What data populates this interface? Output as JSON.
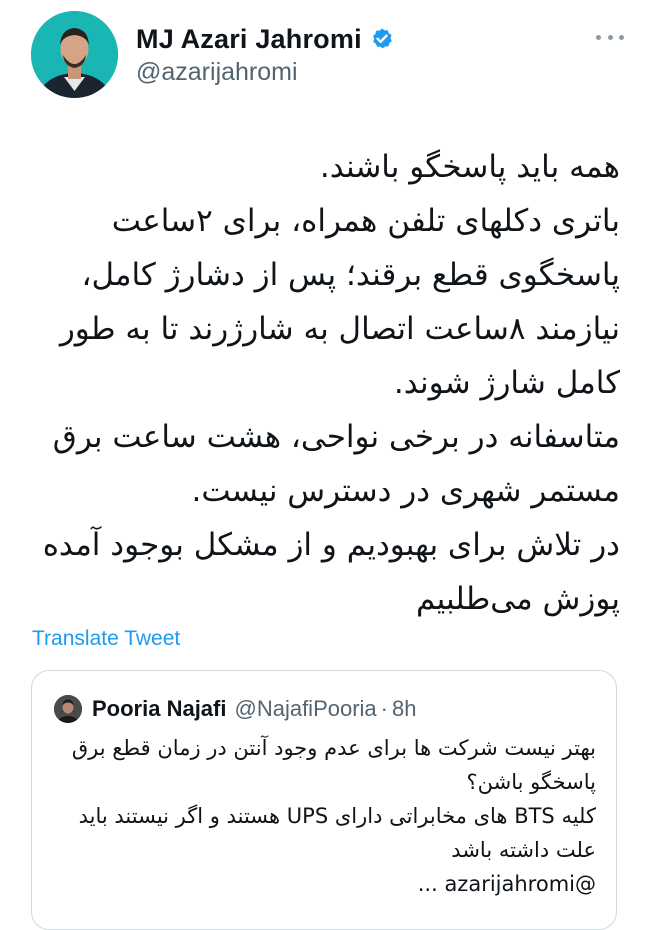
{
  "tweet": {
    "author": {
      "display_name": "MJ Azari Jahromi",
      "handle": "@azarijahromi",
      "verified": true,
      "avatar_icon": "profile-photo"
    },
    "menu_icon": "more-options-icon",
    "body_paragraphs": [
      "همه باید پاسخگو باشند.",
      "باتری دکلهای تلفن همراه، برای ۲ساعت پاسخگوی قطع برقند؛ پس از دشارژ کامل، نیازمند ۸ساعت اتصال به شارژرند تا به طور کامل شارژ شوند.",
      "متاسفانه در برخی نواحی، هشت ساعت برق مستمر شهری در دسترس نیست.",
      "در تلاش برای بهبودیم و از مشکل بوجود آمده پوزش می‌طلبیم"
    ],
    "translate_label": "Translate Tweet"
  },
  "quoted_tweet": {
    "display_name": "Pooria Najafi",
    "handle": "@NajafiPooria",
    "separator": "·",
    "time": "8h",
    "body_paragraphs": [
      "بهتر نیست شرکت ها برای عدم وجود آنتن در زمان قطع برق پاسخگو باشن؟",
      "کلیه BTS های مخابراتی دارای UPS هستند و اگر نیستند باید علت داشته باشد",
      "@azarijahromi ..."
    ]
  },
  "colors": {
    "text": "#0f1419",
    "secondary": "#536471",
    "link": "#1d9bf0",
    "border": "#cfd9de",
    "verified": "#1d9bf0"
  }
}
